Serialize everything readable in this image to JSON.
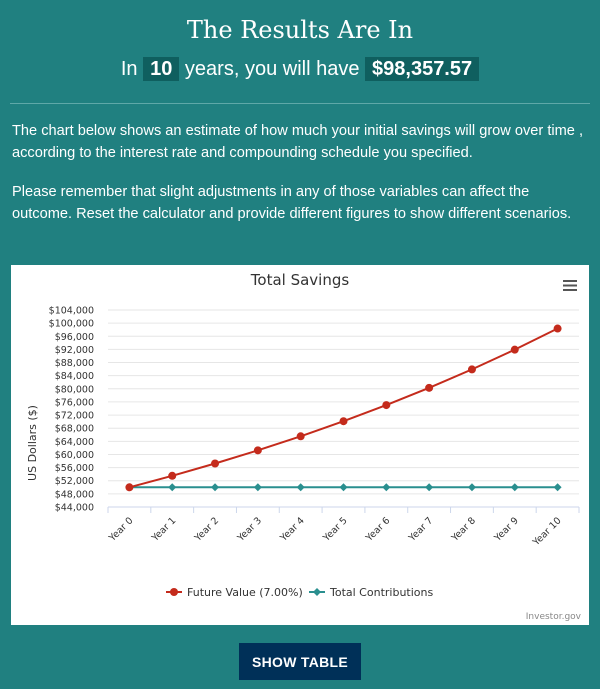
{
  "header": {
    "title": "The Results Are In",
    "prefix": "In",
    "years": "10",
    "middle": "years, you will have",
    "amount": "$98,357.57"
  },
  "body": {
    "paragraph1": "The chart below shows an estimate of how much your initial savings will grow over time , according to the interest rate and compounding schedule you specified.",
    "paragraph2": "Please remember that slight adjustments in any of those variables can affect the outcome. Reset the calculator and provide different figures to show different scenarios."
  },
  "chart_menu_icon": "hamburger-menu-icon",
  "credit": "Investor.gov",
  "show_table_label": "SHOW TABLE",
  "colors": {
    "future_value": "#c42b1c",
    "contributions": "#2a8f8f",
    "background": "#208080",
    "button": "#003058"
  },
  "chart_data": {
    "type": "line",
    "title": "Total Savings",
    "xlabel": "",
    "ylabel": "US Dollars ($)",
    "categories": [
      "Year 0",
      "Year 1",
      "Year 2",
      "Year 3",
      "Year 4",
      "Year 5",
      "Year 6",
      "Year 7",
      "Year 8",
      "Year 9",
      "Year 10"
    ],
    "ylim": [
      44000,
      104000
    ],
    "yticks": [
      44000,
      48000,
      52000,
      56000,
      60000,
      64000,
      68000,
      72000,
      76000,
      80000,
      84000,
      88000,
      92000,
      96000,
      100000,
      104000
    ],
    "grid": true,
    "legend_position": "bottom-center",
    "series": [
      {
        "name": "Future Value (7.00%)",
        "color": "#c42b1c",
        "marker": "circle",
        "values": [
          50000,
          53500,
          57245,
          61252.15,
          65539.8,
          70127.59,
          75036.52,
          80289.08,
          85909.31,
          91922.96,
          98357.57
        ]
      },
      {
        "name": "Total Contributions",
        "color": "#2a8f8f",
        "marker": "diamond",
        "values": [
          50000,
          50000,
          50000,
          50000,
          50000,
          50000,
          50000,
          50000,
          50000,
          50000,
          50000
        ]
      }
    ]
  }
}
